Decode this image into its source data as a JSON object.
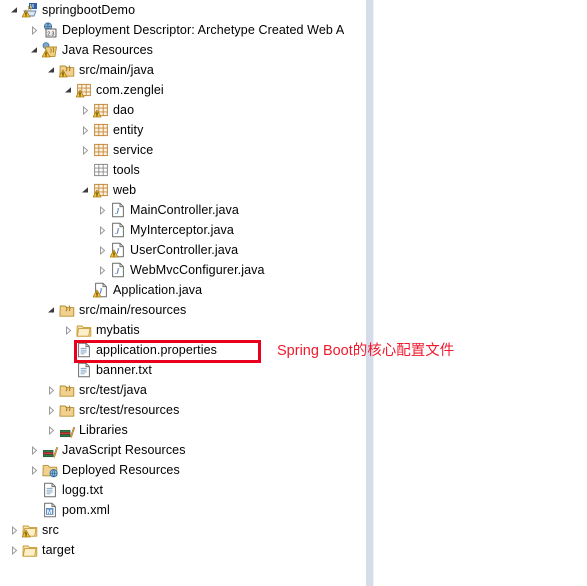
{
  "explorer": {
    "divider_color": "#d6dcea",
    "background": "#ffffff",
    "nodes": [
      {
        "label": "springbootDemo",
        "indent": 0,
        "arrow": "expanded",
        "icon": "java-project-icon",
        "warning": true
      },
      {
        "label": "Deployment Descriptor: Archetype Created Web A",
        "indent": 1,
        "arrow": "collapsed",
        "icon": "deployment-descriptor-icon",
        "warning": false
      },
      {
        "label": "Java Resources",
        "indent": 1,
        "arrow": "expanded",
        "icon": "java-resources-icon",
        "warning": true
      },
      {
        "label": "src/main/java",
        "indent": 2,
        "arrow": "expanded",
        "icon": "source-folder-icon",
        "warning": true
      },
      {
        "label": "com.zenglei",
        "indent": 3,
        "arrow": "expanded",
        "icon": "package-icon",
        "warning": true
      },
      {
        "label": "dao",
        "indent": 4,
        "arrow": "collapsed",
        "icon": "package-icon",
        "warning": true
      },
      {
        "label": "entity",
        "indent": 4,
        "arrow": "collapsed",
        "icon": "package-icon",
        "warning": false
      },
      {
        "label": "service",
        "indent": 4,
        "arrow": "collapsed",
        "icon": "package-icon",
        "warning": false
      },
      {
        "label": "tools",
        "indent": 4,
        "arrow": "none",
        "icon": "empty-package-icon",
        "warning": false
      },
      {
        "label": "web",
        "indent": 4,
        "arrow": "expanded",
        "icon": "package-icon",
        "warning": true
      },
      {
        "label": "MainController.java",
        "indent": 5,
        "arrow": "collapsed",
        "icon": "java-file-icon",
        "warning": false
      },
      {
        "label": "MyInterceptor.java",
        "indent": 5,
        "arrow": "collapsed",
        "icon": "java-file-icon",
        "warning": false
      },
      {
        "label": "UserController.java",
        "indent": 5,
        "arrow": "collapsed",
        "icon": "java-file-icon",
        "warning": true
      },
      {
        "label": "WebMvcConfigurer.java",
        "indent": 5,
        "arrow": "collapsed",
        "icon": "java-file-icon",
        "warning": false
      },
      {
        "label": "Application.java",
        "indent": 4,
        "arrow": "none",
        "icon": "java-file-icon",
        "warning": true
      },
      {
        "label": "src/main/resources",
        "indent": 2,
        "arrow": "expanded",
        "icon": "source-folder-icon",
        "warning": false
      },
      {
        "label": "mybatis",
        "indent": 3,
        "arrow": "collapsed",
        "icon": "folder-icon",
        "warning": false
      },
      {
        "label": "application.properties",
        "indent": 3,
        "arrow": "none",
        "icon": "file-icon",
        "warning": false
      },
      {
        "label": "banner.txt",
        "indent": 3,
        "arrow": "none",
        "icon": "file-icon",
        "warning": false
      },
      {
        "label": "src/test/java",
        "indent": 2,
        "arrow": "collapsed",
        "icon": "source-folder-icon",
        "warning": false
      },
      {
        "label": "src/test/resources",
        "indent": 2,
        "arrow": "collapsed",
        "icon": "source-folder-icon",
        "warning": false
      },
      {
        "label": "Libraries",
        "indent": 2,
        "arrow": "collapsed",
        "icon": "libraries-icon",
        "warning": false
      },
      {
        "label": "JavaScript Resources",
        "indent": 1,
        "arrow": "collapsed",
        "icon": "libraries-icon",
        "warning": false
      },
      {
        "label": "Deployed Resources",
        "indent": 1,
        "arrow": "collapsed",
        "icon": "deployed-resources-icon",
        "warning": false
      },
      {
        "label": "logg.txt",
        "indent": 1,
        "arrow": "none",
        "icon": "file-icon",
        "warning": false
      },
      {
        "label": "pom.xml",
        "indent": 1,
        "arrow": "none",
        "icon": "maven-file-icon",
        "warning": false
      },
      {
        "label": "src",
        "indent": 0,
        "arrow": "collapsed",
        "icon": "folder-icon",
        "warning": true
      },
      {
        "label": "target",
        "indent": 0,
        "arrow": "collapsed",
        "icon": "folder-icon",
        "warning": false
      }
    ]
  },
  "annotation": {
    "text": "Spring Boot的核心配置文件",
    "color": "#ef1a2d"
  },
  "highlight": {
    "target_label": "application.properties",
    "color": "#e8001c"
  }
}
